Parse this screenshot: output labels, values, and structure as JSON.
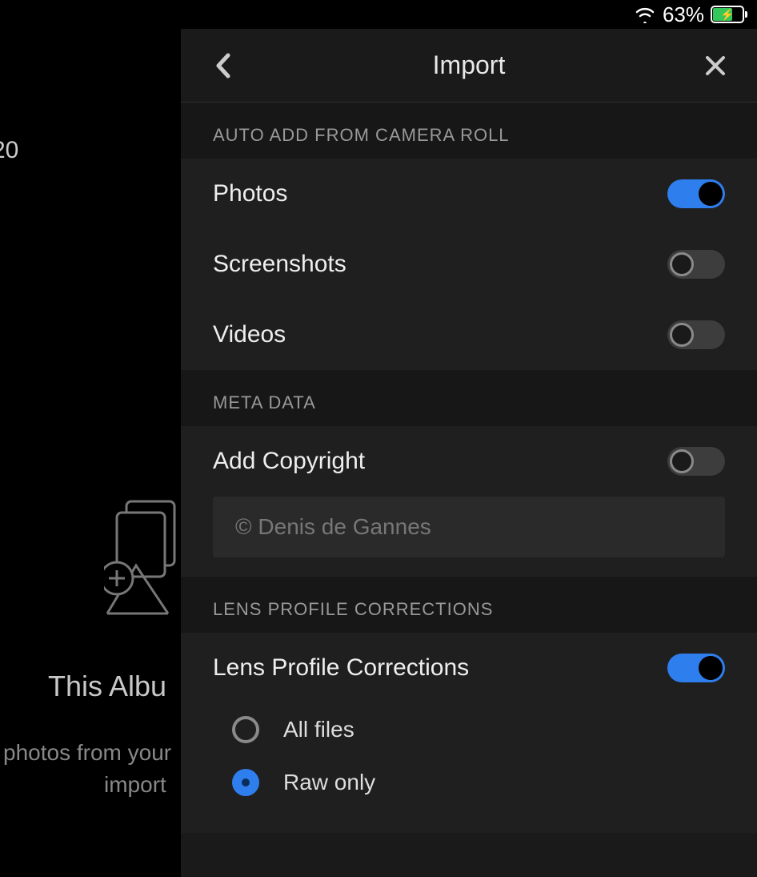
{
  "status": {
    "battery_pct": "63%"
  },
  "background": {
    "top_fragment": "20",
    "title_fragment": "This Albu",
    "line1_fragment": "photos from your",
    "line2_fragment": "import"
  },
  "header": {
    "title": "Import"
  },
  "sections": {
    "auto_add": {
      "header": "AUTO ADD FROM CAMERA ROLL",
      "rows": {
        "photos": {
          "label": "Photos"
        },
        "screenshots": {
          "label": "Screenshots"
        },
        "videos": {
          "label": "Videos"
        }
      }
    },
    "meta": {
      "header": "META DATA",
      "rows": {
        "add_copyright": {
          "label": "Add Copyright"
        }
      },
      "copyright_placeholder": "© Denis de Gannes"
    },
    "lens": {
      "header": "LENS PROFILE CORRECTIONS",
      "rows": {
        "lens_corrections": {
          "label": "Lens Profile Corrections"
        }
      },
      "options": {
        "all_files": "All files",
        "raw_only": "Raw only"
      }
    }
  }
}
